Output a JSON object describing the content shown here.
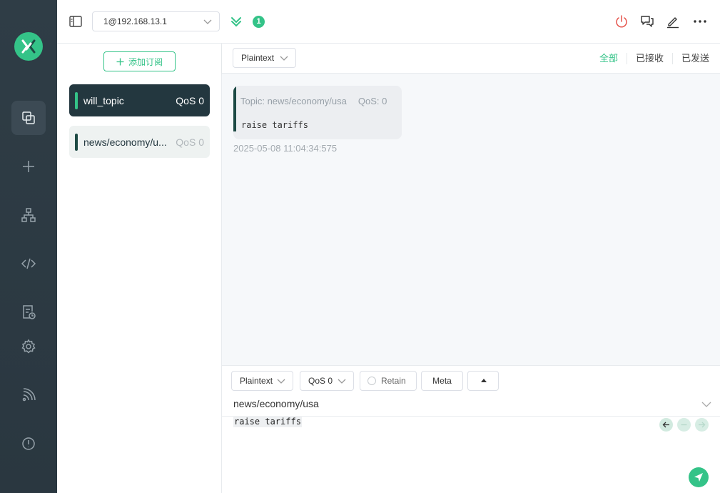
{
  "header": {
    "connection": "1@192.168.13.1",
    "connection_count": "1"
  },
  "subscriptions": {
    "add_label": "添加订阅",
    "items": [
      {
        "topic": "will_topic",
        "qos": "QoS 0",
        "active": true
      },
      {
        "topic": "news/economy/u...",
        "qos": "QoS 0",
        "active": false
      }
    ]
  },
  "message_view": {
    "format": "Plaintext",
    "filters": [
      "全部",
      "已接收",
      "已发送"
    ],
    "messages": [
      {
        "topic_label": "Topic: news/economy/usa",
        "qos_label": "QoS: 0",
        "payload": "raise tariffs",
        "time": "2025-05-08 11:04:34:575"
      }
    ]
  },
  "composer": {
    "format": "Plaintext",
    "qos": "QoS 0",
    "retain_label": "Retain",
    "meta_label": "Meta",
    "topic": "news/economy/usa",
    "payload": "raise tariffs"
  },
  "colors": {
    "accent": "#34c388",
    "rail": "#2f3d46",
    "active_sub": "#23373f",
    "disconnect": "#e5534b"
  }
}
